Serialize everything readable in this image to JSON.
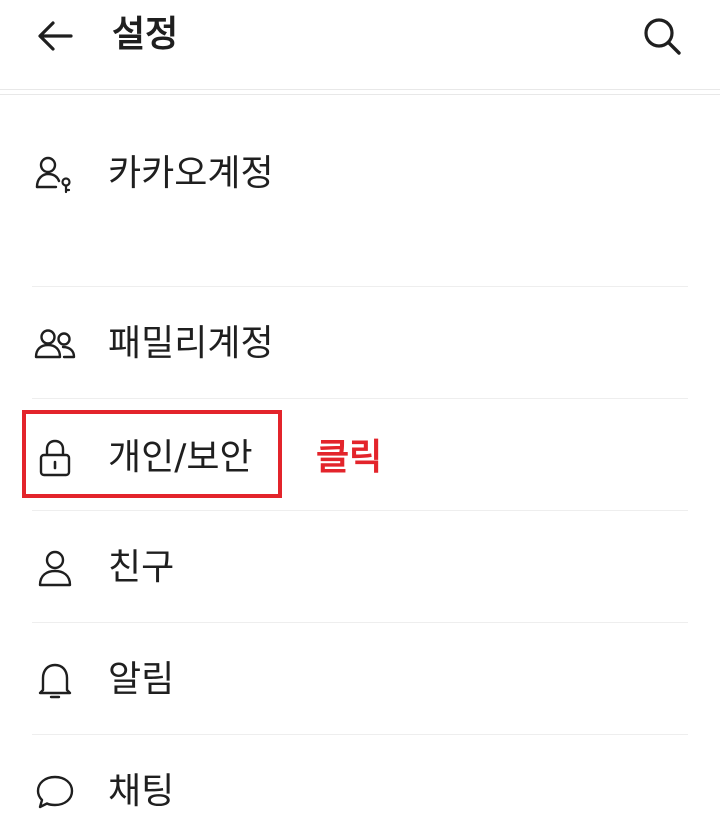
{
  "header": {
    "title": "설정",
    "back_icon": "arrow-left-icon",
    "search_icon": "search-icon"
  },
  "menu": {
    "items": [
      {
        "label": "카카오계정",
        "icon": "account-key-icon"
      },
      {
        "label": "패밀리계정",
        "icon": "people-icon"
      },
      {
        "label": "개인/보안",
        "icon": "lock-icon"
      },
      {
        "label": "친구",
        "icon": "person-icon"
      },
      {
        "label": "알림",
        "icon": "bell-icon"
      },
      {
        "label": "채팅",
        "icon": "chat-bubble-icon"
      }
    ]
  },
  "annotation": {
    "text": "클릭",
    "color": "#e3242b"
  }
}
